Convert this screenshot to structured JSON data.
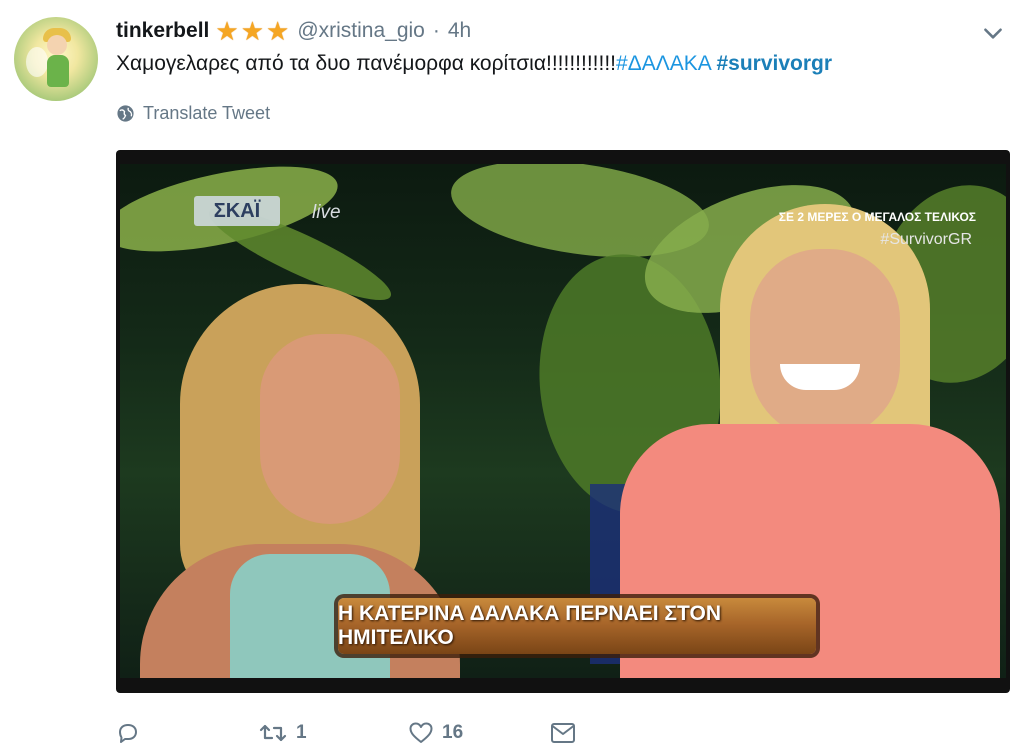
{
  "tweet": {
    "display_name": "tinkerbell",
    "badges": [
      "star-icon",
      "star-icon",
      "star-icon"
    ],
    "handle": "@xristina_gio",
    "separator": "·",
    "timestamp": "4h",
    "text_plain": "Χαμογελαρες από τα δυο πανέμορφα κορίτσια!!!!!!!!!!!!",
    "hashtag_1": "#ΔΑΛΑΚΑ",
    "hashtag_2": "#survivorgr",
    "translate_label": "Translate Tweet"
  },
  "media": {
    "channel_logo": "ΣΚΑΪ",
    "live_label": "live",
    "top_caption": "ΣΕ 2 ΜΕΡΕΣ Ο ΜΕΓΑΛΟΣ ΤΕΛΙΚΟΣ",
    "hashtag": "#SurvivorGR",
    "lower_third": "Η ΚΑΤΕΡΙΝΑ ΔΑΛΑΚΑ ΠΕΡΝΑΕΙ ΣΤΟΝ ΗΜΙΤΕΛΙΚΟ"
  },
  "actions": {
    "reply_icon": "reply-icon",
    "retweet_icon": "retweet-icon",
    "retweet_count": "1",
    "like_icon": "heart-icon",
    "like_count": "16",
    "dm_icon": "envelope-icon"
  },
  "colors": {
    "link": "#1b95e0",
    "muted": "#657786",
    "star": "#f5a623"
  }
}
